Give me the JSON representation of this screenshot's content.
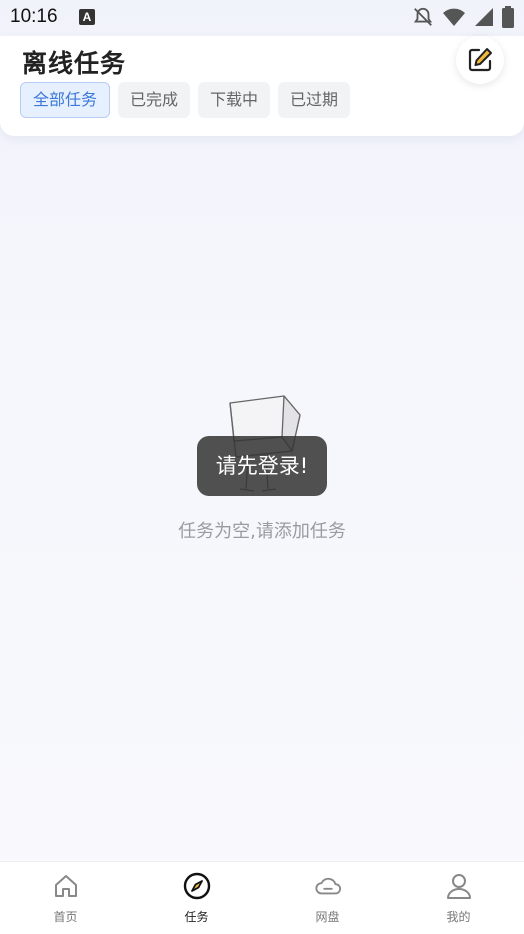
{
  "status_bar": {
    "time": "10:16",
    "notification_icon": "A",
    "icons": [
      "bell-off-icon",
      "wifi-icon",
      "signal-icon",
      "battery-icon"
    ]
  },
  "header": {
    "title": "离线任务",
    "edit_icon": "edit-icon"
  },
  "tabs": [
    {
      "label": "全部任务",
      "active": true
    },
    {
      "label": "已完成",
      "active": false
    },
    {
      "label": "下载中",
      "active": false
    },
    {
      "label": "已过期",
      "active": false
    }
  ],
  "empty_state": {
    "text": "任务为空,请添加任务"
  },
  "toast": {
    "text": "请先登录!"
  },
  "bottom_nav": [
    {
      "label": "首页",
      "icon": "home-icon",
      "active": false
    },
    {
      "label": "任务",
      "icon": "compass-icon",
      "active": true
    },
    {
      "label": "网盘",
      "icon": "cloud-icon",
      "active": false
    },
    {
      "label": "我的",
      "icon": "user-icon",
      "active": false
    }
  ],
  "colors": {
    "accent": "#3b78d8",
    "active_tab_bg": "#e7f0ff",
    "toast_bg": "#343434",
    "edit_icon_accent": "#f2b83b"
  }
}
